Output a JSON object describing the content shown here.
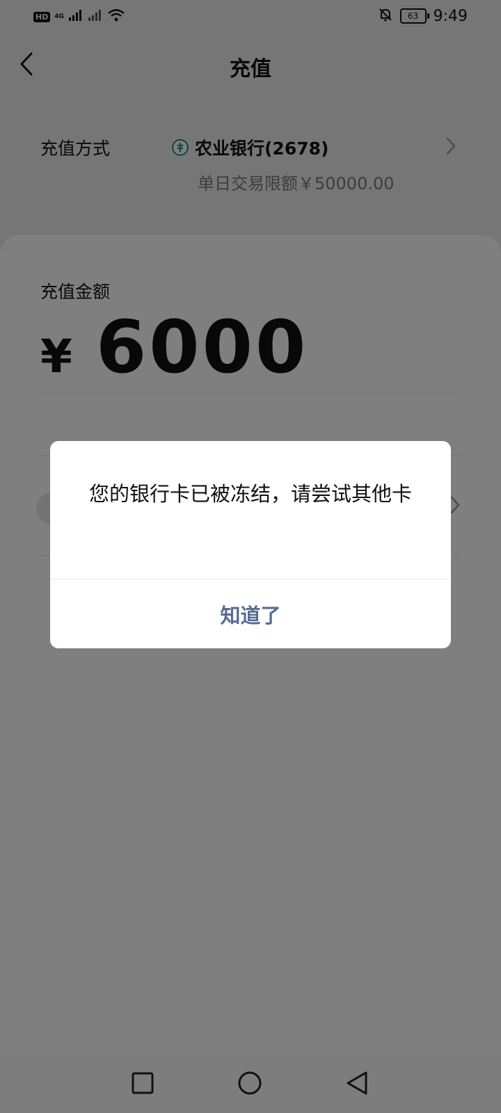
{
  "status_bar": {
    "time": "9:49",
    "battery": "63",
    "hd_label": "HD",
    "network_label": "4G"
  },
  "header": {
    "title": "充值"
  },
  "payment_method": {
    "label": "充值方式",
    "bank_name": "农业银行(2678)",
    "daily_limit": "单日交易限额￥50000.00"
  },
  "amount": {
    "label": "充值金额",
    "currency": "¥",
    "value": "6000"
  },
  "dialog": {
    "message": "您的银行卡已被冻结，请尝试其他卡",
    "confirm_label": "知道了"
  },
  "colors": {
    "dialog_button": "#576b95",
    "bank_logo": "#0d8b69"
  },
  "icons": {
    "back": "chevron-left-icon",
    "chevron": "chevron-right-icon",
    "nav_recent": "square-icon",
    "nav_home": "circle-icon",
    "nav_back": "triangle-back-icon"
  }
}
